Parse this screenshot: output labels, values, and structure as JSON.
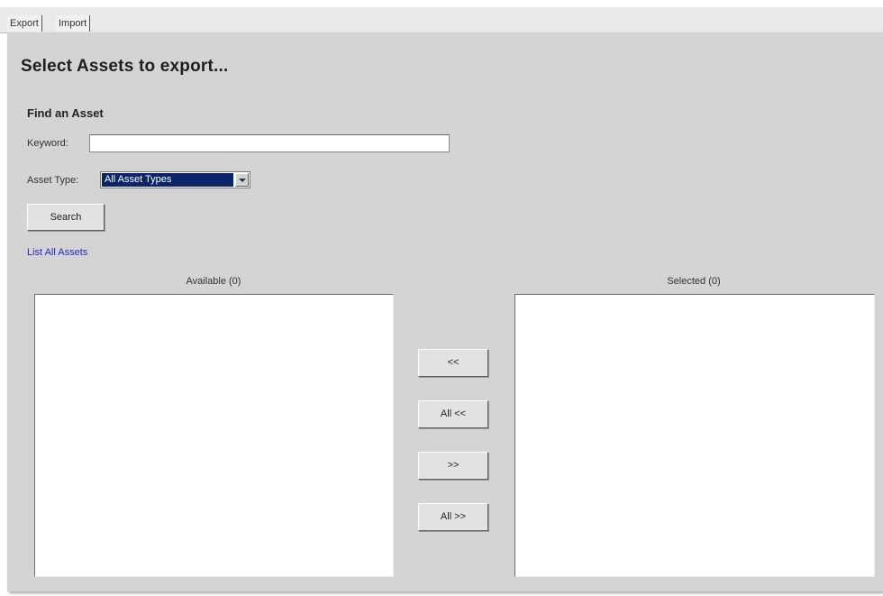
{
  "tabs": [
    {
      "label": "Export",
      "active": true
    },
    {
      "label": "Import",
      "active": false
    }
  ],
  "page": {
    "title": "Select Assets to export...",
    "find_heading": "Find an Asset"
  },
  "search": {
    "keyword_label": "Keyword:",
    "keyword_value": "",
    "asset_type_label": "Asset Type:",
    "asset_type_selected": "All Asset Types",
    "search_button": "Search",
    "list_all_link": "List All Assets"
  },
  "lists": {
    "available_header": "Available (0)",
    "selected_header": "Selected (0)",
    "available_items": [],
    "selected_items": []
  },
  "transfer_buttons": {
    "remove": "<<",
    "remove_all": "All <<",
    "add": ">>",
    "add_all": "All >>"
  },
  "colors": {
    "panel_background": "#d4d4d4",
    "selection_highlight": "#0a246a",
    "link": "#2626c8"
  }
}
